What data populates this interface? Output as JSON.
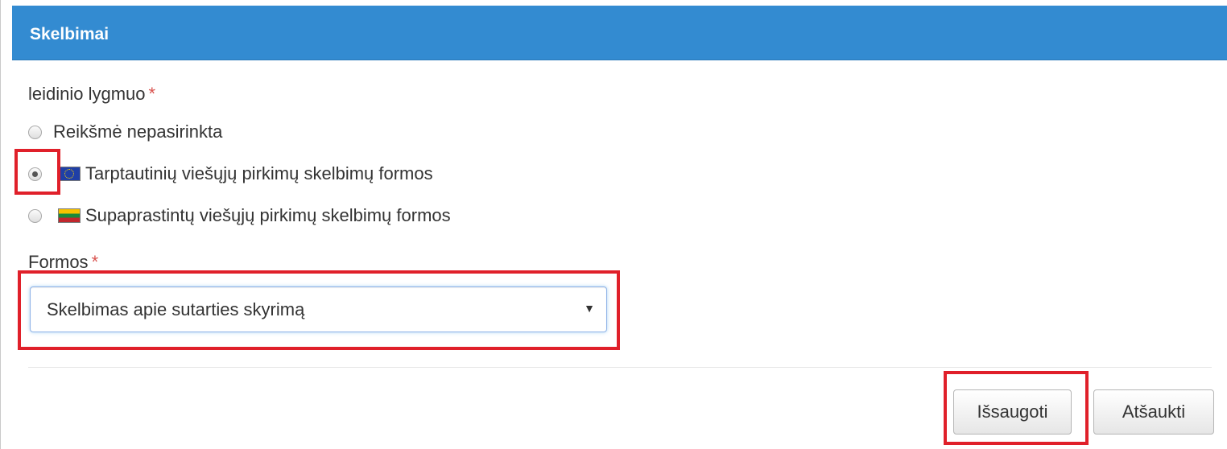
{
  "header": {
    "title": "Skelbimai"
  },
  "level": {
    "label": "leidinio lygmuo",
    "required_mark": "*",
    "options": [
      {
        "label": "Reikšmė nepasirinkta",
        "selected": false,
        "flag": "none"
      },
      {
        "label": "Tarptautinių viešųjų pirkimų skelbimų formos",
        "selected": true,
        "flag": "eu-flag"
      },
      {
        "label": "Supaprastintų viešųjų pirkimų skelbimų formos",
        "selected": false,
        "flag": "lithuania-flag"
      }
    ]
  },
  "forms": {
    "label": "Formos",
    "required_mark": "*",
    "selected_value": "Skelbimas apie sutarties skyrimą",
    "caret": "▼"
  },
  "footer": {
    "save_label": "Išsaugoti",
    "cancel_label": "Atšaukti"
  },
  "colors": {
    "header_bg": "#338bd1",
    "highlight": "#e0202a",
    "required": "#d9534f"
  }
}
